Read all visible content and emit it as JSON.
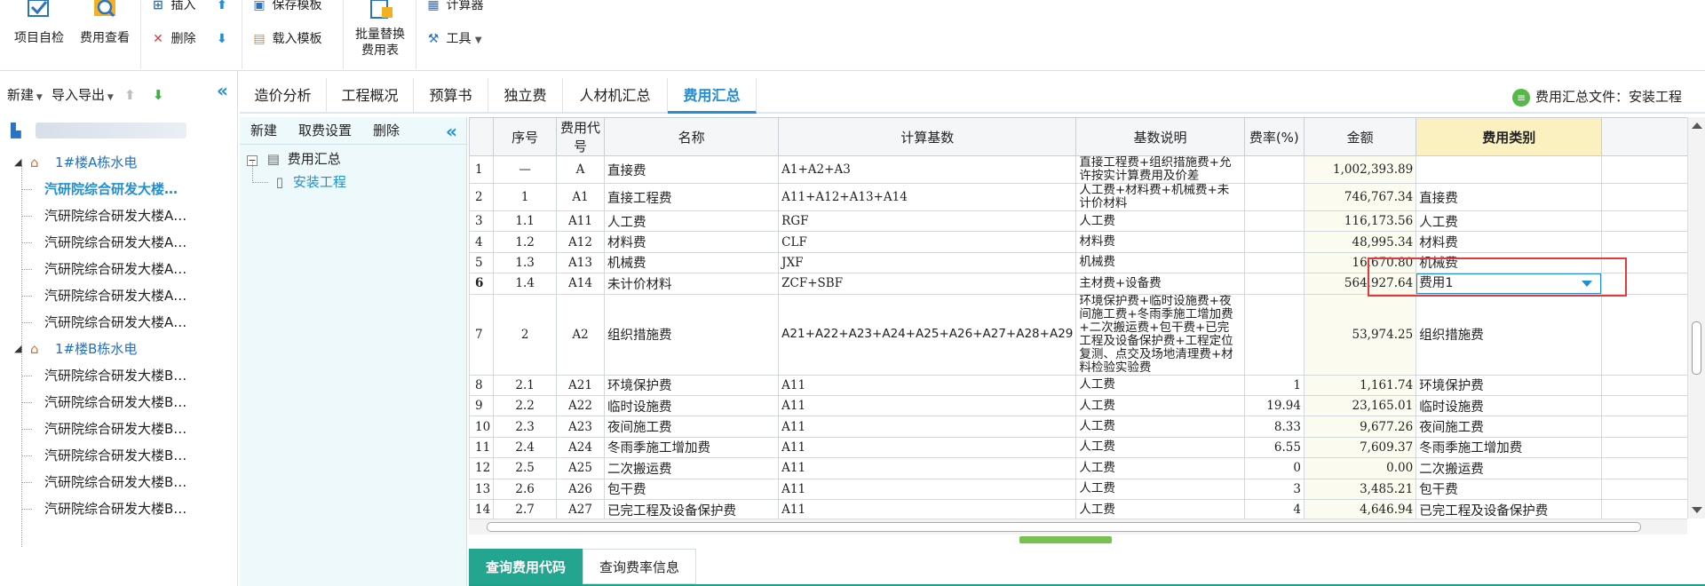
{
  "toolbar": {
    "project_check": "项目自检",
    "fee_view": "费用查看",
    "insert": "插入",
    "delete": "删除",
    "save_template": "保存模板",
    "load_template": "载入模板",
    "batch_replace_line1": "批量替换",
    "batch_replace_line2": "费用表",
    "calculator": "计算器",
    "tools": "工具"
  },
  "left": {
    "new": "新建",
    "import_export": "导入导出",
    "tree": [
      {
        "label": "1#楼A栋水电",
        "type": "group"
      },
      {
        "label": "汽研院综合研发大楼…",
        "type": "item",
        "selected": true
      },
      {
        "label": "汽研院综合研发大楼A…",
        "type": "item"
      },
      {
        "label": "汽研院综合研发大楼A…",
        "type": "item"
      },
      {
        "label": "汽研院综合研发大楼A…",
        "type": "item"
      },
      {
        "label": "汽研院综合研发大楼A…",
        "type": "item"
      },
      {
        "label": "汽研院综合研发大楼A…",
        "type": "item"
      },
      {
        "label": "1#楼B栋水电",
        "type": "group"
      },
      {
        "label": "汽研院综合研发大楼B…",
        "type": "item"
      },
      {
        "label": "汽研院综合研发大楼B…",
        "type": "item"
      },
      {
        "label": "汽研院综合研发大楼B…",
        "type": "item"
      },
      {
        "label": "汽研院综合研发大楼B…",
        "type": "item"
      },
      {
        "label": "汽研院综合研发大楼B…",
        "type": "item"
      },
      {
        "label": "汽研院综合研发大楼B…",
        "type": "item"
      }
    ]
  },
  "tabs": [
    "造价分析",
    "工程概况",
    "预算书",
    "独立费",
    "人材机汇总",
    "费用汇总"
  ],
  "active_tab": "费用汇总",
  "file_label": "费用汇总文件：安装工程",
  "subpanel": {
    "new": "新建",
    "fee_settings": "取费设置",
    "delete": "删除",
    "root": "费用汇总",
    "child": "安装工程"
  },
  "grid": {
    "headers": [
      "",
      "序号",
      "费用代号",
      "名称",
      "计算基数",
      "基数说明",
      "费率(%)",
      "金额",
      "费用类别",
      ""
    ],
    "rows": [
      [
        "1",
        "—",
        "A",
        "直接费",
        "A1+A2+A3",
        "直接工程费+组织措施费+允许按实计算费用及价差",
        "",
        "1,002,393.89",
        ""
      ],
      [
        "2",
        "1",
        "A1",
        "直接工程费",
        "A11+A12+A13+A14",
        "人工费+材料费+机械费+未计价材料",
        "",
        "746,767.34",
        "直接费"
      ],
      [
        "3",
        "1.1",
        "A11",
        "人工费",
        "RGF",
        "人工费",
        "",
        "116,173.56",
        "人工费"
      ],
      [
        "4",
        "1.2",
        "A12",
        "材料费",
        "CLF",
        "材料费",
        "",
        "48,995.34",
        "材料费"
      ],
      [
        "5",
        "1.3",
        "A13",
        "机械费",
        "JXF",
        "机械费",
        "",
        "16,670.80",
        "机械费"
      ],
      [
        "6",
        "1.4",
        "A14",
        "未计价材料",
        "ZCF+SBF",
        "主材费+设备费",
        "",
        "564,927.64",
        "费用1"
      ],
      [
        "7",
        "2",
        "A2",
        "组织措施费",
        "A21+A22+A23+A24+A25+A26+A27+A28+A29",
        "环境保护费+临时设施费+夜间施工费+冬雨季施工增加费+二次搬运费+包干费+已完工程及设备保护费+工程定位复测、点交及场地清理费+材料检验实验费",
        "",
        "53,974.25",
        "组织措施费"
      ],
      [
        "8",
        "2.1",
        "A21",
        "环境保护费",
        "A11",
        "人工费",
        "1",
        "1,161.74",
        "环境保护费"
      ],
      [
        "9",
        "2.2",
        "A22",
        "临时设施费",
        "A11",
        "人工费",
        "19.94",
        "23,165.01",
        "临时设施费"
      ],
      [
        "10",
        "2.3",
        "A23",
        "夜间施工费",
        "A11",
        "人工费",
        "8.33",
        "9,677.26",
        "夜间施工费"
      ],
      [
        "11",
        "2.4",
        "A24",
        "冬雨季施工增加费",
        "A11",
        "人工费",
        "6.55",
        "7,609.37",
        "冬雨季施工增加费"
      ],
      [
        "12",
        "2.5",
        "A25",
        "二次搬运费",
        "A11",
        "人工费",
        "0",
        "0.00",
        "二次搬运费"
      ],
      [
        "13",
        "2.6",
        "A26",
        "包干费",
        "A11",
        "人工费",
        "3",
        "3,485.21",
        "包干费"
      ],
      [
        "14",
        "2.7",
        "A27",
        "已完工程及设备保护费",
        "A11",
        "人工费",
        "4",
        "4,646.94",
        "已完工程及设备保护费"
      ]
    ],
    "current_row": 6
  },
  "bottom_tabs": [
    "查询费用代码",
    "查询费率信息"
  ],
  "colors": {
    "accent": "#1f8fd6",
    "green": "#23a58f",
    "highlight": "#fbf0bf",
    "red": "#e23b3b"
  }
}
